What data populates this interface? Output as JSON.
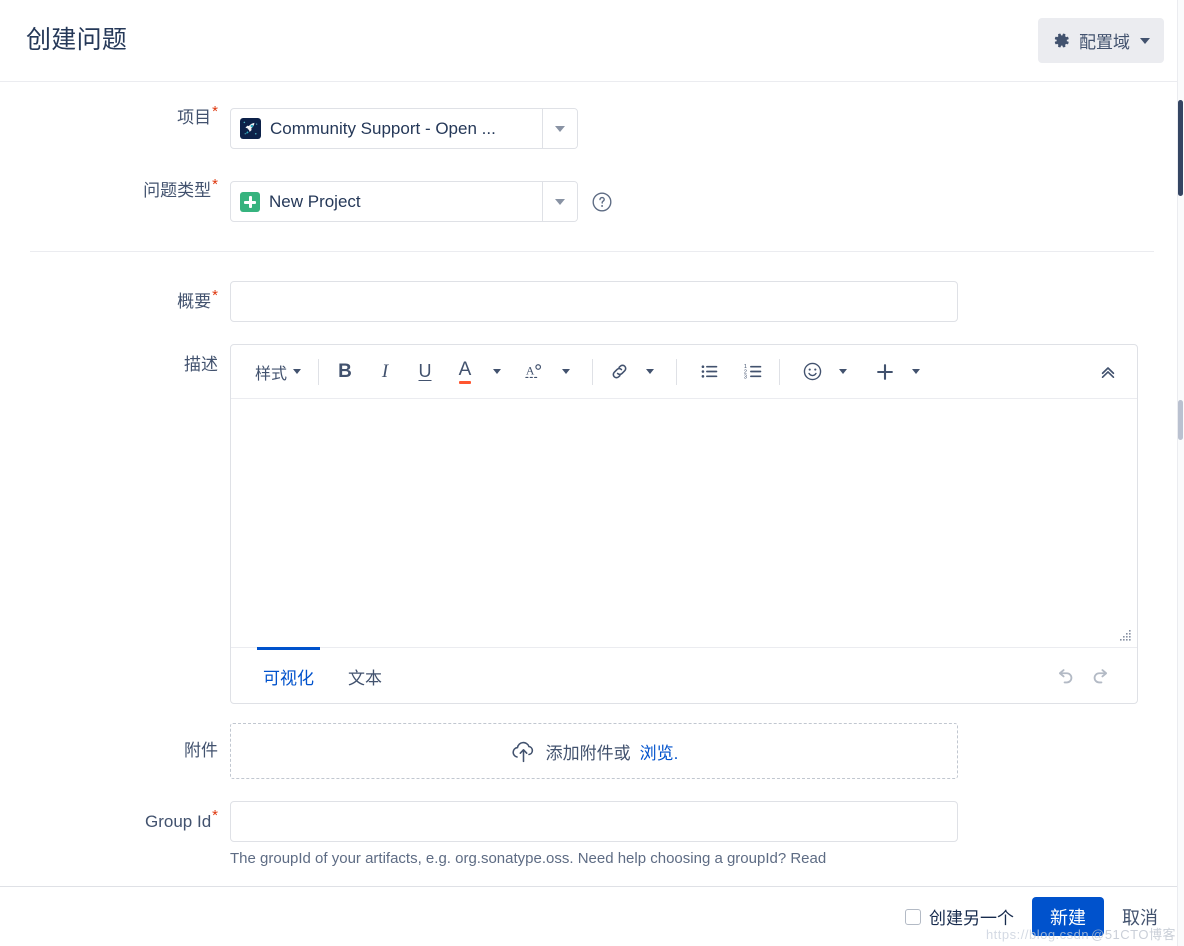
{
  "header": {
    "title": "创建问题",
    "config_button": {
      "label": "配置域",
      "icon": "gear-icon",
      "caret": "chevron-down-icon"
    }
  },
  "form": {
    "project": {
      "label": "项目",
      "required": true,
      "value": "Community Support - Open ...",
      "icon": "rocket-icon"
    },
    "issue_type": {
      "label": "问题类型",
      "required": true,
      "value": "New Project",
      "icon": "plus-square-icon",
      "help_icon": "question-circle-icon"
    },
    "summary": {
      "label": "概要",
      "required": true,
      "value": "",
      "placeholder": ""
    },
    "description": {
      "label": "描述",
      "required": false,
      "value": "",
      "toolbar": {
        "style_label": "样式",
        "bold": "B",
        "italic": "I",
        "underline": "U",
        "text_color": "A",
        "more_formatting": "A²",
        "link": "link-icon",
        "bullet_list": "bullet-list-icon",
        "numbered_list": "numbered-list-icon",
        "emoji": "emoji-icon",
        "insert": "plus-icon",
        "collapse": "chevron-double-up-icon"
      },
      "tabs": [
        {
          "label": "可视化",
          "active": true
        },
        {
          "label": "文本",
          "active": false
        }
      ],
      "undo": "undo-icon",
      "redo": "redo-icon",
      "resize": "resize-grip-icon"
    },
    "attachment": {
      "label": "附件",
      "drop_text": "添加附件或",
      "browse_link": "浏览.",
      "icon": "cloud-upload-icon"
    },
    "group_id": {
      "label": "Group Id",
      "required": true,
      "value": "",
      "help_text": "The groupId of your artifacts, e.g. org.sonatype.oss. Need help choosing a groupId? Read"
    }
  },
  "footer": {
    "create_another_label": "创建另一个",
    "create_another_checked": false,
    "submit_label": "新建",
    "cancel_label": "取消"
  },
  "watermark": {
    "url": "https://blog.csdn",
    "text": "@51CTO博客"
  },
  "colors": {
    "accent": "#0052cc",
    "title": "#253858",
    "required": "#de350b",
    "label": "#42526e",
    "border": "#dfe1e6",
    "toolbar_divider": "#ebecf0",
    "green": "#36b37e",
    "link": "#0052cc"
  }
}
